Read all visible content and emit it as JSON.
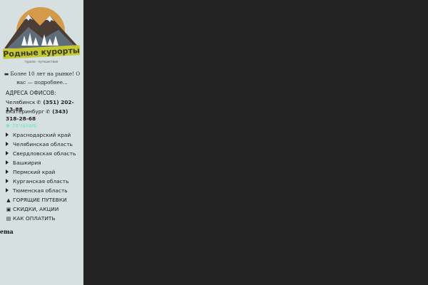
{
  "logo": {
    "brand_text": "Родные курорты",
    "sub_text": "туризм · путешествия"
  },
  "tagline": {
    "icon": "briefcase-icon",
    "text": "Более 10 лет на рынке! О нас — подробнее..."
  },
  "offices": {
    "title": "АДРЕСА ОФИСОВ:",
    "items": [
      {
        "city": "Челябинск",
        "phone": "(351) 202-13-88"
      },
      {
        "city": "Екатеринбург",
        "phone": "(343) 318-28-68"
      }
    ]
  },
  "regions": {
    "heading": "✱ ЛЕЧЕНИЕ",
    "items": [
      {
        "label": "Краснодарский край"
      },
      {
        "label": "Челябинская область"
      },
      {
        "label": "Свердловская область"
      },
      {
        "label": "Башкирия"
      },
      {
        "label": "Пермский край"
      },
      {
        "label": "Курганская область"
      },
      {
        "label": "Тюменская область"
      }
    ]
  },
  "links": [
    {
      "label": "ГОРЯЩИЕ ПУТЕВКИ",
      "icon": "fire-icon"
    },
    {
      "label": "СКИДКИ, АКЦИИ",
      "icon": "gift-icon"
    },
    {
      "label": "КАК ОПЛАТИТЬ",
      "icon": "card-icon"
    }
  ],
  "cut_text": "ema",
  "colors": {
    "sidebar_bg": "#d6e0e0",
    "main_bg": "#232323",
    "accent": "#72e7c2"
  }
}
